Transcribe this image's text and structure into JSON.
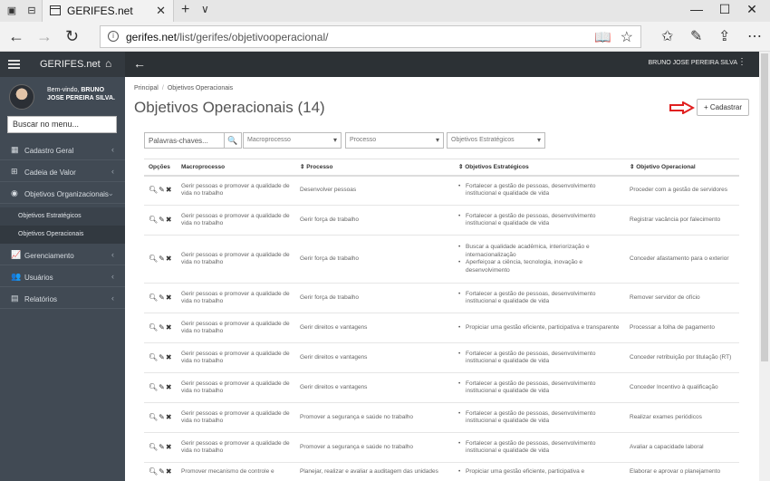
{
  "browser": {
    "tab_title": "GERIFES.net",
    "url_domain": "gerifes.net",
    "url_path": "/list/gerifes/objetivooperacional/"
  },
  "app": {
    "brand": "GERIFES.net",
    "welcome": "Bem-vindo,",
    "user_short": "BRUNO JOSE PEREIRA SILVA.",
    "user_full": "BRUNO JOSE PEREIRA SILVA",
    "menu_search_placeholder": "Buscar no menu..."
  },
  "sidebar": {
    "items": [
      {
        "label": "Cadastro Geral",
        "icon": "grid-icon"
      },
      {
        "label": "Cadeia de Valor",
        "icon": "sitemap-icon"
      },
      {
        "label": "Objetivos Organizacionais",
        "icon": "target-icon"
      },
      {
        "label": "Gerenciamento",
        "icon": "chart-icon"
      },
      {
        "label": "Usuários",
        "icon": "users-icon"
      },
      {
        "label": "Relatórios",
        "icon": "report-icon"
      }
    ],
    "subitems": [
      {
        "label": "Objetivos Estratégicos"
      },
      {
        "label": "Objetivos Operacionais"
      }
    ]
  },
  "breadcrumb": {
    "home": "Principal",
    "current": "Objetivos Operacionais"
  },
  "page": {
    "title": "Objetivos Operacionais (14)",
    "add_button": "+ Cadastrar"
  },
  "filters": {
    "keywords": "Palavras-chaves...",
    "macroprocesso": "Macroprocesso",
    "processo": "Processo",
    "objetivos_estrategicos": "Objetivos Estratégicos"
  },
  "table": {
    "headers": [
      "Opções",
      "Macroprocesso",
      "⇕ Processo",
      "⇕ Objetivos Estratégicos",
      "⇕ Objetivo Operacional"
    ],
    "rows": [
      {
        "macro": "Gerir pessoas e promover a qualidade de vida no trabalho",
        "processo": "Desenvolver pessoas",
        "estrategicos": [
          "Fortalecer a gestão de pessoas, desenvolvimento institucional e qualidade de vida"
        ],
        "operacional": "Proceder com a gestão de servidores"
      },
      {
        "macro": "Gerir pessoas e promover a qualidade de vida no trabalho",
        "processo": "Gerir força de trabalho",
        "estrategicos": [
          "Fortalecer a gestão de pessoas, desenvolvimento institucional e qualidade de vida"
        ],
        "operacional": "Registrar vacância por falecimento"
      },
      {
        "macro": "Gerir pessoas e promover a qualidade de vida no trabalho",
        "processo": "Gerir força de trabalho",
        "estrategicos": [
          "Buscar a qualidade acadêmica, interiorização e internacionalização",
          "Aperfeiçoar a ciência, tecnologia, inovação e desenvolvimento"
        ],
        "operacional": "Conceder afastamento para o exterior"
      },
      {
        "macro": "Gerir pessoas e promover a qualidade de vida no trabalho",
        "processo": "Gerir força de trabalho",
        "estrategicos": [
          "Fortalecer a gestão de pessoas, desenvolvimento institucional e qualidade de vida"
        ],
        "operacional": "Remover servidor de ofício"
      },
      {
        "macro": "Gerir pessoas e promover a qualidade de vida no trabalho",
        "processo": "Gerir direitos e vantagens",
        "estrategicos": [
          "Propiciar uma gestão eficiente, participativa e transparente"
        ],
        "operacional": "Processar a folha de pagamento"
      },
      {
        "macro": "Gerir pessoas e promover a qualidade de vida no trabalho",
        "processo": "Gerir direitos e vantagens",
        "estrategicos": [
          "Fortalecer a gestão de pessoas, desenvolvimento institucional e qualidade de vida"
        ],
        "operacional": "Conceder retribuição por titulação (RT)"
      },
      {
        "macro": "Gerir pessoas e promover a qualidade de vida no trabalho",
        "processo": "Gerir direitos e vantagens",
        "estrategicos": [
          "Fortalecer a gestão de pessoas, desenvolvimento institucional e qualidade de vida"
        ],
        "operacional": "Conceder Incentivo à qualificação"
      },
      {
        "macro": "Gerir pessoas e promover a qualidade de vida no trabalho",
        "processo": "Promover a segurança e saúde no trabalho",
        "estrategicos": [
          "Fortalecer a gestão de pessoas, desenvolvimento institucional e qualidade de vida"
        ],
        "operacional": "Realizar exames periódicos"
      },
      {
        "macro": "Gerir pessoas e promover a qualidade de vida no trabalho",
        "processo": "Promover a segurança e saúde no trabalho",
        "estrategicos": [
          "Fortalecer a gestão de pessoas, desenvolvimento institucional e qualidade de vida"
        ],
        "operacional": "Avaliar a capacidade laboral"
      },
      {
        "macro": "Promover mecanismo de controle e",
        "processo": "Planejar, realizar e avaliar a auditagem das unidades",
        "estrategicos": [
          "Propiciar uma gestão eficiente, participativa e"
        ],
        "operacional": "Elaborar e aprovar o planejamento"
      }
    ]
  },
  "colors": {
    "sidebar": "#414a54",
    "topnav": "#2c3135",
    "arrow": "#e02020"
  }
}
